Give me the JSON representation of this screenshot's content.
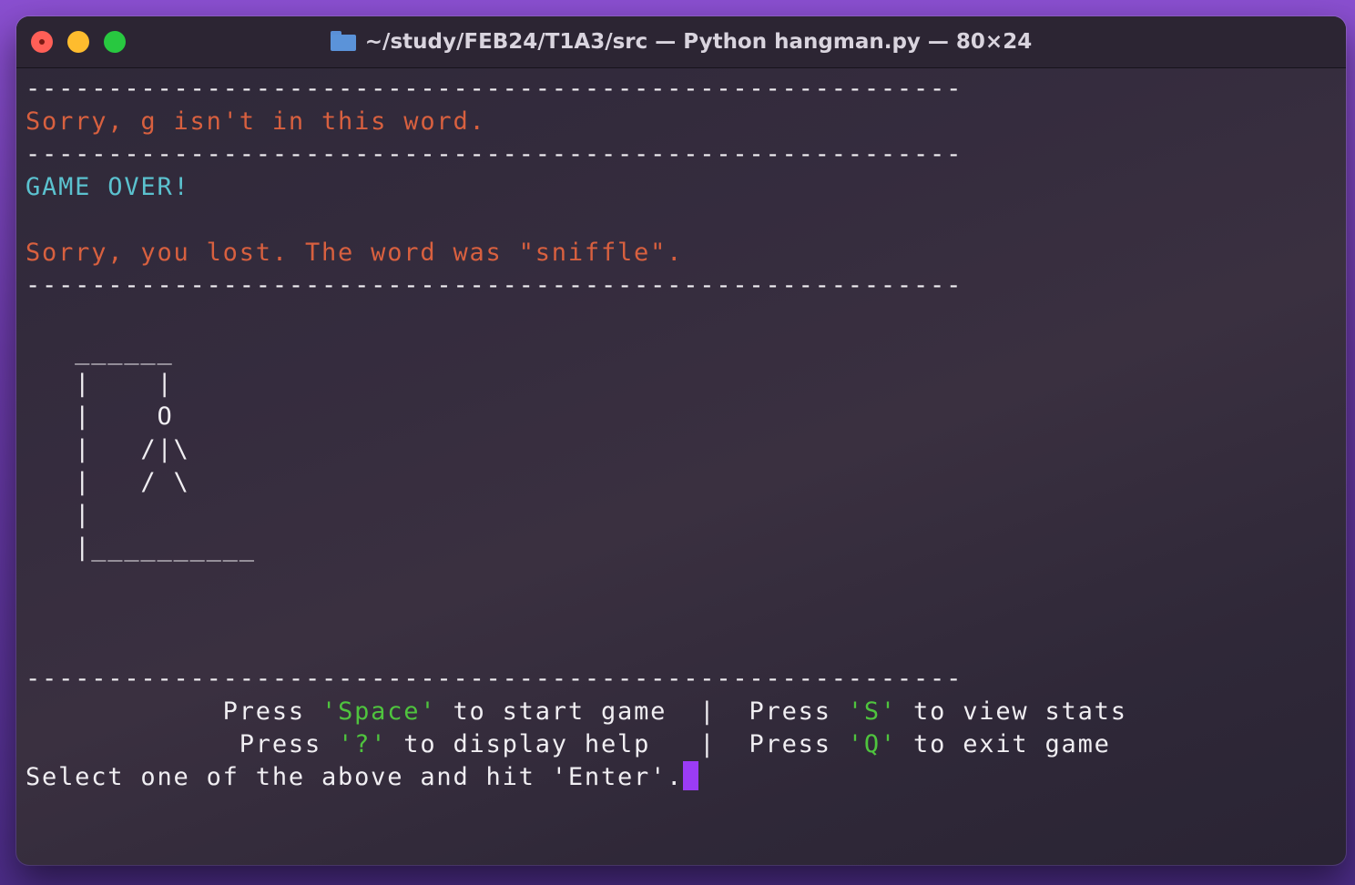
{
  "window": {
    "title": "~/study/FEB24/T1A3/src — Python hangman.py — 80×24"
  },
  "terminal": {
    "divider": "---------------------------------------------------------",
    "msg_wrong": "Sorry, g isn't in this word.",
    "game_over": "GAME OVER!",
    "msg_lost": "Sorry, you lost. The word was \"sniffle\".",
    "hangman": [
      "   ______",
      "   |    |",
      "   |    O",
      "   |   /|\\",
      "   |   / \\",
      "   |",
      "   |__________"
    ],
    "menu": {
      "row1": {
        "indent": "            ",
        "p1": "Press ",
        "k1": "'Space'",
        "t1": " to start game  |  ",
        "p2": "Press ",
        "k2": "'S'",
        "t2": " to view stats"
      },
      "row2": {
        "indent": "             ",
        "p1": "Press ",
        "k1": "'?'",
        "t1": " to display help   |  ",
        "p2": "Press ",
        "k2": "'Q'",
        "t2": " to exit game"
      }
    },
    "prompt": "Select one of the above and hit 'Enter'."
  },
  "colors": {
    "error": "#d8603f",
    "heading": "#5bc2cf",
    "key": "#4fc43e",
    "cursor": "#9b3cf5"
  }
}
